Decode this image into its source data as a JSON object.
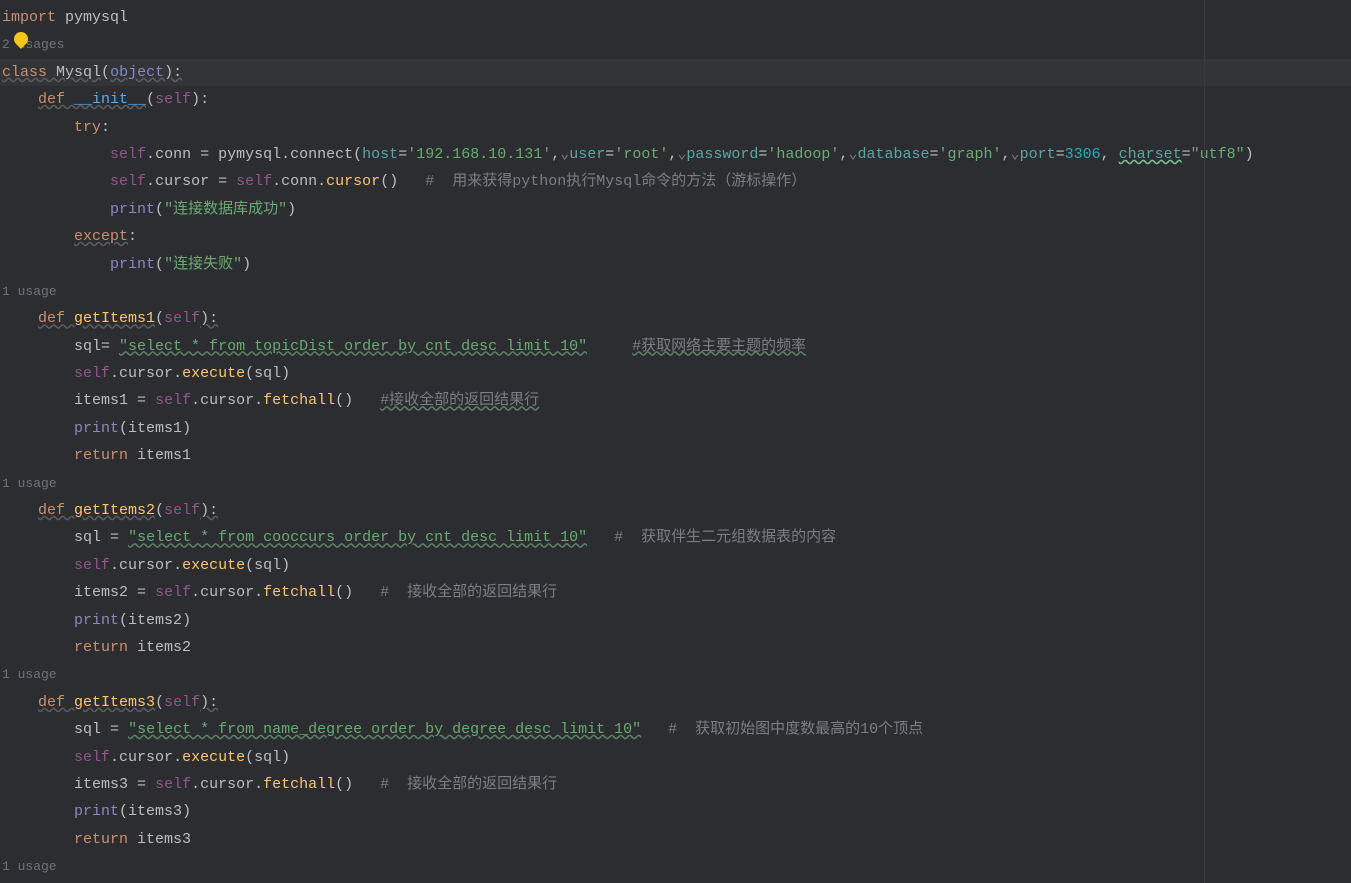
{
  "import_kw": "import",
  "import_mod": "pymysql",
  "usage_2": "2 usages",
  "usage_1a": "1 usage",
  "usage_1b": "1 usage",
  "usage_1c": "1 usage",
  "usage_1d": "1 usage",
  "class_kw": "class",
  "class_name": "Mysql",
  "object_name": "object",
  "def_kw": "def",
  "init_name": "__init__",
  "self_kw": "self",
  "try_kw": "try",
  "except_kw": "except",
  "return_kw": "return",
  "conn_attr": "conn",
  "connect_fn": "connect",
  "host_param": "host",
  "host_val": "'192.168.10.131'",
  "user_param": "user",
  "user_val": "'root'",
  "password_param": "password",
  "password_val": "'hadoop'",
  "database_param": "database",
  "database_val": "'graph'",
  "port_param": "port",
  "port_val": "3306",
  "charset_param": "charset",
  "charset_val": "\"utf8\"",
  "cursor_attr": "cursor",
  "cursor_fn": "cursor",
  "comment_cursor": "#  用来获得python执行Mysql命令的方法（游标操作）",
  "print_fn": "print",
  "conn_success": "\"连接数据库成功\"",
  "conn_fail": "\"连接失败\"",
  "getItems1": "getItems1",
  "getItems2": "getItems2",
  "getItems3": "getItems3",
  "sql_var": "sql",
  "sql1_val": "\"select * from topicDist order by cnt desc limit 10\"",
  "sql2_val": "\"select * from cooccurs order by cnt desc limit 10\"",
  "sql3_val": "\"select * from name_degree order by degree desc limit 10\"",
  "comment_sql1": "#获取网络主要主题的频率",
  "comment_sql2": "#  获取伴生二元组数据表的内容",
  "comment_sql3": "#  获取初始图中度数最高的10个顶点",
  "execute_fn": "execute",
  "fetchall_fn": "fetchall",
  "items1_var": "items1",
  "items2_var": "items2",
  "items3_var": "items3",
  "comment_fetch": "#接收全部的返回结果行",
  "comment_fetch_sp": "#  接收全部的返回结果行",
  "eq": "= ",
  "comma_arrow": ","
}
